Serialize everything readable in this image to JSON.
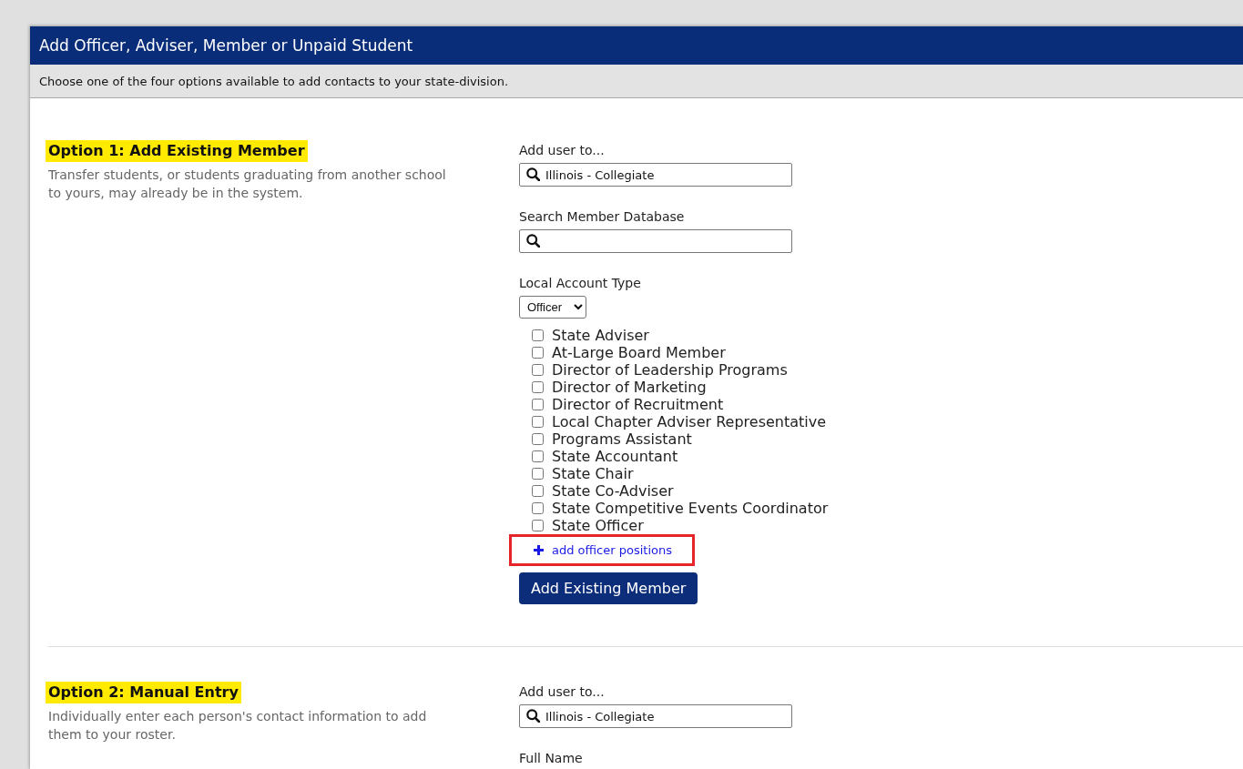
{
  "window": {
    "title": "Add Officer, Adviser, Member or Unpaid Student"
  },
  "intro": "Choose one of the four options available to add contacts to your state-division.",
  "options": [
    {
      "heading": "Option 1: Add Existing Member",
      "highlighted": true,
      "description": "Transfer students, or students graduating from another school to yours, may already be in the system.",
      "fields": [
        {
          "kind": "search",
          "label": "Add user to...",
          "value": "Illinois - Collegiate"
        },
        {
          "kind": "search",
          "label": "Search Member Database"
        },
        {
          "kind": "select",
          "label": "Local Account Type",
          "value": "Officer",
          "checkboxes": [
            {
              "label": "State Adviser",
              "checked": false
            },
            {
              "label": "At-Large Board Member",
              "checked": false
            },
            {
              "label": "Director of Leadership Programs",
              "checked": false
            },
            {
              "label": "Director of Marketing",
              "checked": false
            },
            {
              "label": "Director of Recruitment",
              "checked": false
            },
            {
              "label": "Local Chapter Adviser Representative",
              "checked": false
            },
            {
              "label": "Programs Assistant",
              "checked": false
            },
            {
              "label": "State Accountant",
              "checked": false
            },
            {
              "label": "State Chair",
              "checked": false
            },
            {
              "label": "State Co-Adviser",
              "checked": false
            },
            {
              "label": "State Competitive Events Coordinator",
              "checked": false
            },
            {
              "label": "State Officer",
              "checked": false
            }
          ],
          "link": {
            "label": "add officer positions",
            "annotated": true
          }
        }
      ],
      "button": "Add Existing Member"
    },
    {
      "heading": "Option 2: Manual Entry",
      "highlighted": true,
      "description": "Individually enter each person's contact information to add them to your roster.",
      "fields": [
        {
          "kind": "search",
          "label": "Add user to...",
          "value": "Illinois - Collegiate"
        },
        {
          "kind": "label",
          "label": "Full Name"
        }
      ]
    }
  ]
}
